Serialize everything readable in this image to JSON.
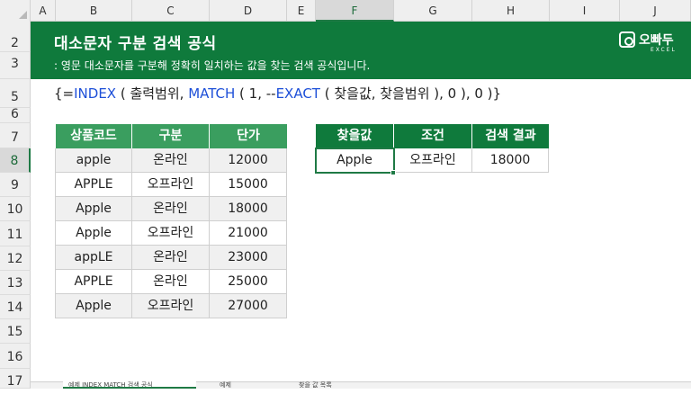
{
  "columns": [
    "A",
    "B",
    "C",
    "D",
    "E",
    "F",
    "G",
    "H",
    "I",
    "J"
  ],
  "rows": [
    "2",
    "3",
    "5",
    "6",
    "7",
    "8",
    "9",
    "10",
    "11",
    "12",
    "13",
    "14",
    "15",
    "16",
    "17"
  ],
  "selected_column": "F",
  "selected_row": "8",
  "banner": {
    "title": "대소문자 구분 검색 공식",
    "subtitle": ": 영문 대소문자를 구분해 정확히 일치하는 값을 찾는 검색 공식입니다.",
    "logo_text": "오빠두",
    "logo_sub": "EXCEL"
  },
  "formula": {
    "open": "{=",
    "index": "INDEX",
    "part1": " ( 출력범위, ",
    "match": "MATCH",
    "part2": " ( 1, --",
    "exact": "EXACT",
    "part3": " ( 찾을값, 찾을범위 ), 0 ), 0 )}"
  },
  "product_table": {
    "headers": [
      "상품코드",
      "구분",
      "단가"
    ],
    "rows": [
      [
        "apple",
        "온라인",
        "12000"
      ],
      [
        "APPLE",
        "오프라인",
        "15000"
      ],
      [
        "Apple",
        "온라인",
        "18000"
      ],
      [
        "Apple",
        "오프라인",
        "21000"
      ],
      [
        "appLE",
        "온라인",
        "23000"
      ],
      [
        "APPLE",
        "온라인",
        "25000"
      ],
      [
        "Apple",
        "오프라인",
        "27000"
      ]
    ]
  },
  "search_table": {
    "headers": [
      "찾을값",
      "조건",
      "검색 결과"
    ],
    "values": [
      "Apple",
      "오프라인",
      "18000"
    ]
  },
  "sheet_tabs": [
    "예제 INDEX MATCH 검색 공식",
    "예제",
    "찾을 값 목록"
  ]
}
